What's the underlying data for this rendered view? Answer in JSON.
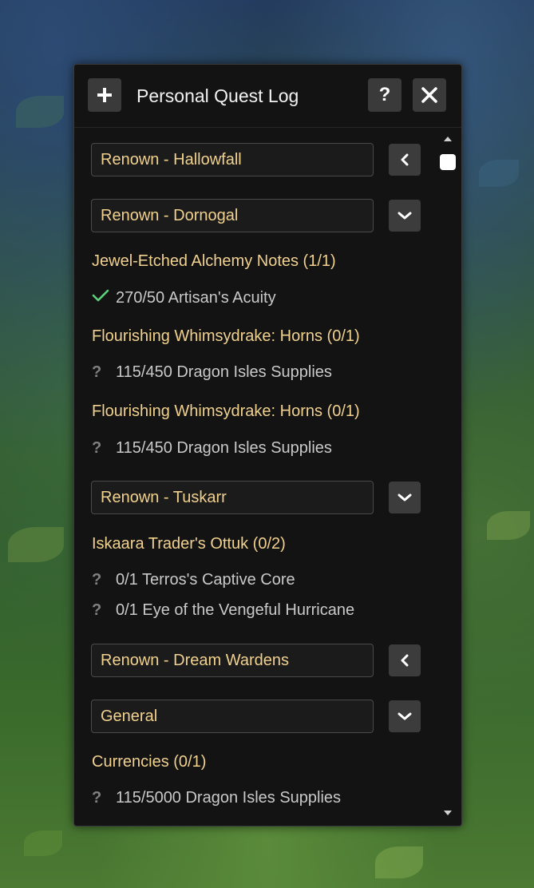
{
  "window": {
    "title": "Personal Quest Log",
    "add_icon": "plus-icon",
    "help_label": "?",
    "close_icon": "close-icon"
  },
  "sections": [
    {
      "label": "Renown - Hallowfall",
      "state": "collapsed",
      "toggle_icon": "chevron-left-icon"
    },
    {
      "label": "Renown - Dornogal",
      "state": "expanded",
      "toggle_icon": "chevron-down-icon"
    },
    {
      "label": "Renown - Tuskarr",
      "state": "expanded",
      "toggle_icon": "chevron-down-icon"
    },
    {
      "label": "Renown - Dream Wardens",
      "state": "collapsed",
      "toggle_icon": "chevron-left-icon"
    },
    {
      "label": "General",
      "state": "expanded",
      "toggle_icon": "chevron-down-icon"
    }
  ],
  "quests": [
    {
      "title": "Jewel-Etched Alchemy Notes (1/1)"
    },
    {
      "title": "Flourishing Whimsydrake: Horns (0/1)"
    },
    {
      "title": "Flourishing Whimsydrake: Horns (0/1)"
    },
    {
      "title": "Iskaara Trader's Ottuk (0/2)"
    },
    {
      "title": "Currencies (0/1)"
    }
  ],
  "objectives": [
    {
      "text": "270/50 Artisan's Acuity",
      "status": "complete",
      "icon": "check-icon"
    },
    {
      "text": "115/450 Dragon Isles Supplies",
      "status": "incomplete",
      "icon": "question-icon"
    },
    {
      "text": "115/450 Dragon Isles Supplies",
      "status": "incomplete",
      "icon": "question-icon"
    },
    {
      "text": "0/1 Terros's Captive Core",
      "status": "incomplete",
      "icon": "question-icon"
    },
    {
      "text": "0/1 Eye of the Vengeful Hurricane",
      "status": "incomplete",
      "icon": "question-icon"
    },
    {
      "text": "115/5000 Dragon Isles Supplies",
      "status": "incomplete",
      "icon": "question-icon"
    }
  ],
  "question_glyph": "?",
  "colors": {
    "quest_title": "#f1d18e",
    "objective_text": "#c9c9c9",
    "check": "#5ed07a",
    "panel_bg": "#131313"
  }
}
